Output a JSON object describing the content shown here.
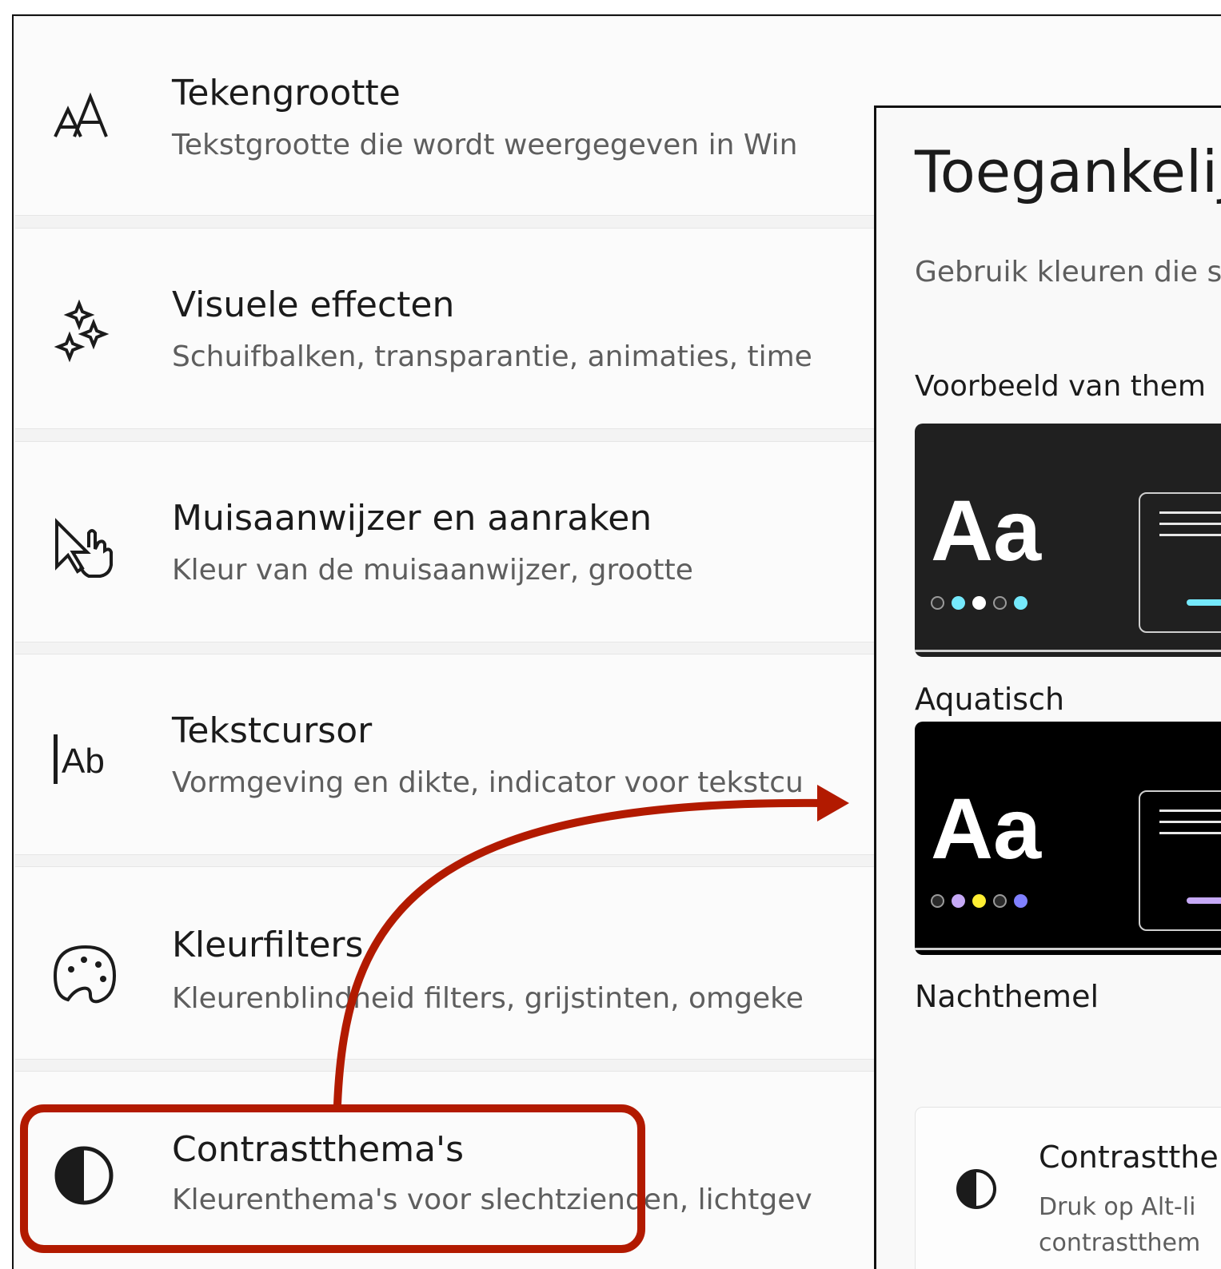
{
  "settings_list": {
    "items": [
      {
        "title": "Tekengrootte",
        "description": "Tekstgrootte die wordt weergegeven in Win",
        "icon": "text-size-icon"
      },
      {
        "title": "Visuele effecten",
        "description": "Schuifbalken, transparantie, animaties, time",
        "icon": "sparkle-icon"
      },
      {
        "title": "Muisaanwijzer en aanraken",
        "description": "Kleur van de muisaanwijzer, grootte",
        "icon": "mouse-pointer-touch-icon"
      },
      {
        "title": "Tekstcursor",
        "description": "Vormgeving en dikte, indicator voor tekstcu",
        "icon": "text-cursor-icon"
      },
      {
        "title": "Kleurfilters",
        "description": "Kleurenblindheid filters, grijstinten, omgeke",
        "icon": "palette-icon"
      },
      {
        "title": "Contrastthema's",
        "description": "Kleurenthema's voor slechtzienden, lichtgev",
        "icon": "contrast-icon"
      }
    ]
  },
  "panel": {
    "heading": "Toegankelij",
    "subtitle": "Gebruik kleuren die s",
    "preview_label": "Voorbeeld van them",
    "themes": [
      {
        "name": "Aquatisch",
        "sample": "Aa",
        "background": "#202020",
        "dots": [
          "#2a2a2a",
          "#75e9fc",
          "#ffffff",
          "#2a2a2a",
          "#75e9fc"
        ],
        "button_color": "#75e9fc"
      },
      {
        "name": "Nachthemel",
        "sample": "Aa",
        "background": "#000000",
        "dots": [
          "#2a2a2a",
          "#c6a9f6",
          "#ffee32",
          "#2a2a2a",
          "#8080ff"
        ],
        "button_color": "#c6a9f6"
      }
    ],
    "setting_card": {
      "title": "Contrastther",
      "description_line1": "Druk op Alt-li",
      "description_line2": "contrastthem"
    }
  },
  "annotation": {
    "highlight_color": "#b21a00"
  }
}
